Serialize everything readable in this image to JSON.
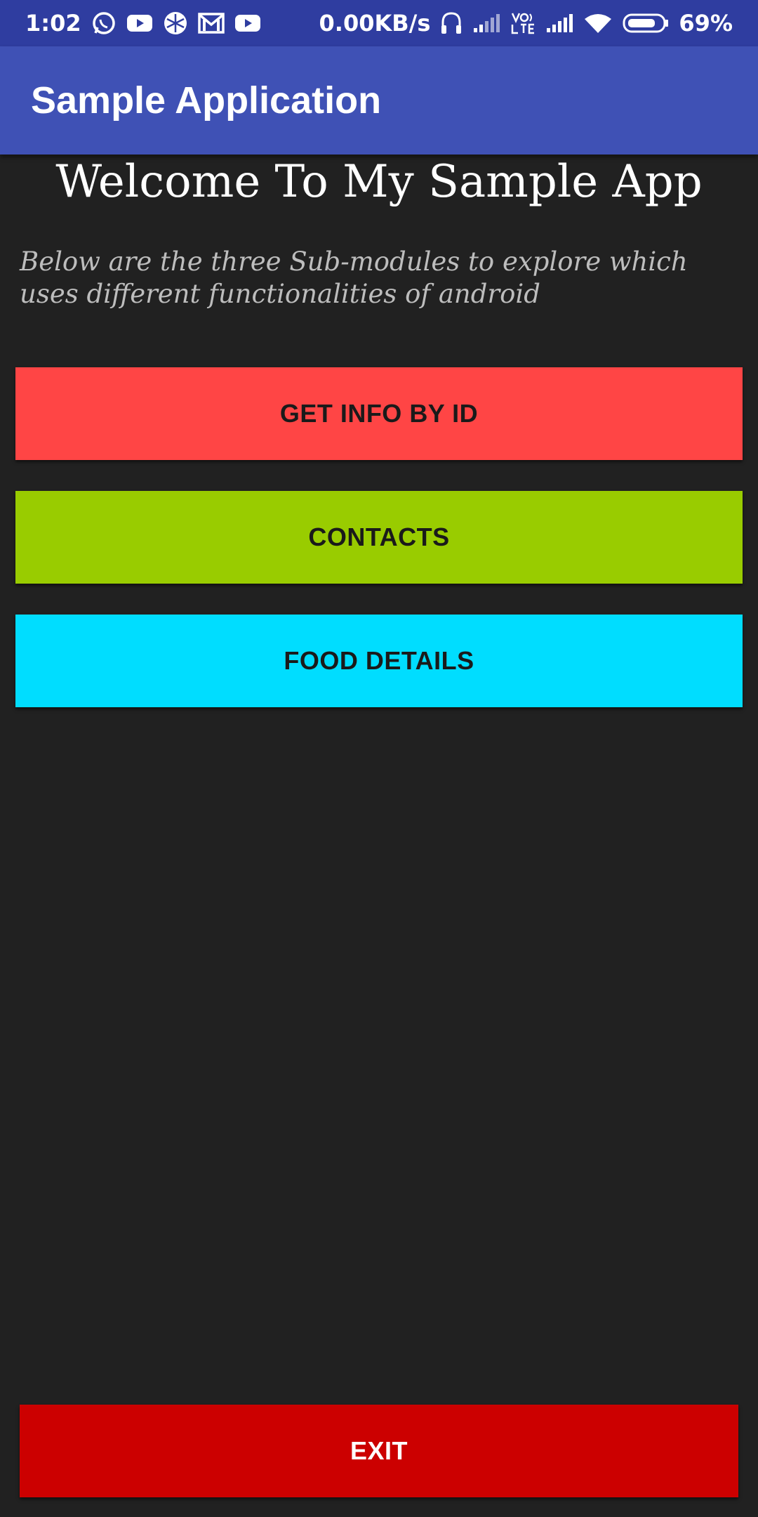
{
  "status_bar": {
    "time": "1:02",
    "notification_icons": [
      "whatsapp-icon",
      "youtube-icon",
      "app-icon",
      "gmail-icon",
      "youtube-icon"
    ],
    "net_speed": "0.00KB/s",
    "battery": "69%",
    "status_icons": [
      "headset-icon",
      "signal-icon",
      "volte-icon",
      "signal-icon",
      "wifi-icon",
      "battery-icon"
    ]
  },
  "app_bar": {
    "title": "Sample Application"
  },
  "main": {
    "welcome": "Welcome To My Sample App",
    "subtitle": "Below are the three Sub-modules to explore which uses different functionalities of android"
  },
  "buttons": {
    "get_info": "GET INFO BY ID",
    "contacts": "CONTACTS",
    "food_details": "FOOD DETAILS",
    "exit": "EXIT"
  },
  "colors": {
    "status_bar": "#2f3da0",
    "app_bar": "#3f51b5",
    "background": "#212121",
    "get_info": "#ff4545",
    "contacts": "#99cc00",
    "food_details": "#00ddff",
    "exit": "#cc0000"
  }
}
